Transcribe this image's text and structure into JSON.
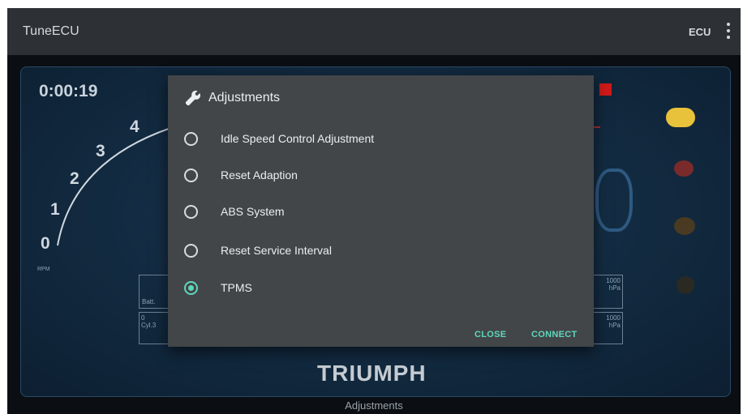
{
  "appbar": {
    "title": "TuneECU",
    "ecu_button": "ECU",
    "menu_icon": "more-vert-icon"
  },
  "dashboard": {
    "timer": "0:00:19",
    "rpm_scale": [
      "4",
      "3",
      "2",
      "1",
      "0"
    ],
    "rpm_unit": "RPM",
    "brand": "TRIUMPH"
  },
  "left_boxes": [
    {
      "label": "Batt."
    },
    {
      "label": "0\nCyl.3"
    }
  ],
  "right_boxes": [
    {
      "value": "1000",
      "unit": "hPa"
    },
    {
      "value": "1000",
      "unit": "hPa"
    }
  ],
  "dialog": {
    "title": "Adjustments",
    "title_icon": "wrench-icon",
    "options": [
      {
        "label": "Idle Speed Control Adjustment",
        "checked": false
      },
      {
        "label": "Reset Adaption",
        "checked": false
      },
      {
        "label": "ABS System",
        "checked": false
      },
      {
        "label": "Reset Service Interval",
        "checked": false
      },
      {
        "label": "TPMS",
        "checked": true
      }
    ],
    "close_label": "CLOSE",
    "connect_label": "CONNECT",
    "accent_color": "#5fd6bc"
  },
  "footer": {
    "label": "Adjustments"
  }
}
